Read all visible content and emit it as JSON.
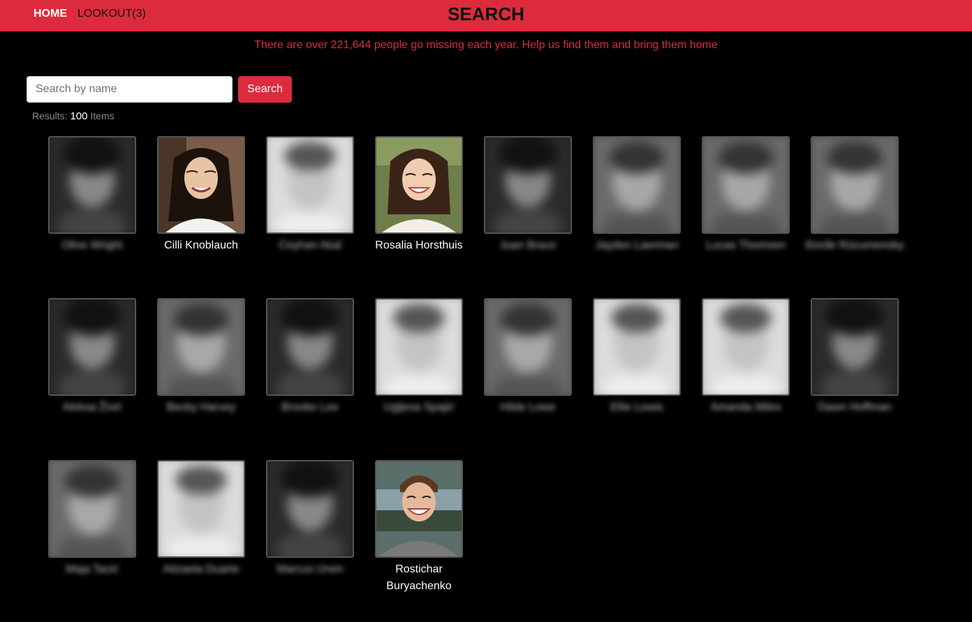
{
  "nav": {
    "home_label": "HOME",
    "lookout_label": "LOOKOUT(3)"
  },
  "header": {
    "title": "SEARCH"
  },
  "tagline": "There are over 221,644 people go missing each year. Help us find them and bring them home",
  "search": {
    "placeholder": "Search by name",
    "value": "",
    "button_label": "Search"
  },
  "results": {
    "label": "Results:",
    "count": "100",
    "unit": "Items"
  },
  "people": [
    {
      "name": "Olive Wright",
      "blurred": true,
      "tone": "dark"
    },
    {
      "name": "Cilli Knoblauch",
      "blurred": false,
      "tone": "asian-woman"
    },
    {
      "name": "Ceyhan Akal",
      "blurred": true,
      "tone": "light"
    },
    {
      "name": "Rosalia Horsthuis",
      "blurred": false,
      "tone": "smiling-woman"
    },
    {
      "name": "Juan Bravo",
      "blurred": true,
      "tone": "dark"
    },
    {
      "name": "Jayden Laerman",
      "blurred": true,
      "tone": "mid"
    },
    {
      "name": "Lucas Thomsen",
      "blurred": true,
      "tone": "mid"
    },
    {
      "name": "Đorđe Rücumensky",
      "blurred": true,
      "tone": "mid"
    },
    {
      "name": "Aleksa Živić",
      "blurred": true,
      "tone": "dark"
    },
    {
      "name": "Becky Harvey",
      "blurred": true,
      "tone": "mid"
    },
    {
      "name": "Brooke Lee",
      "blurred": true,
      "tone": "dark"
    },
    {
      "name": "Ugljesa Spajić",
      "blurred": true,
      "tone": "light"
    },
    {
      "name": "Hilde Lowe",
      "blurred": true,
      "tone": "mid"
    },
    {
      "name": "Ellie Lewis",
      "blurred": true,
      "tone": "light"
    },
    {
      "name": "Amanda Miles",
      "blurred": true,
      "tone": "light"
    },
    {
      "name": "Dawn Hoffman",
      "blurred": true,
      "tone": "dark"
    },
    {
      "name": "Maja Tacić",
      "blurred": true,
      "tone": "mid"
    },
    {
      "name": "Aitzaela Duarte",
      "blurred": true,
      "tone": "light"
    },
    {
      "name": "Marcus Urein",
      "blurred": true,
      "tone": "dark"
    },
    {
      "name": "Rostichar Buryachenko",
      "blurred": false,
      "tone": "young-man"
    }
  ],
  "colors": {
    "brand_red": "#dc2b3c",
    "background": "#000000"
  }
}
